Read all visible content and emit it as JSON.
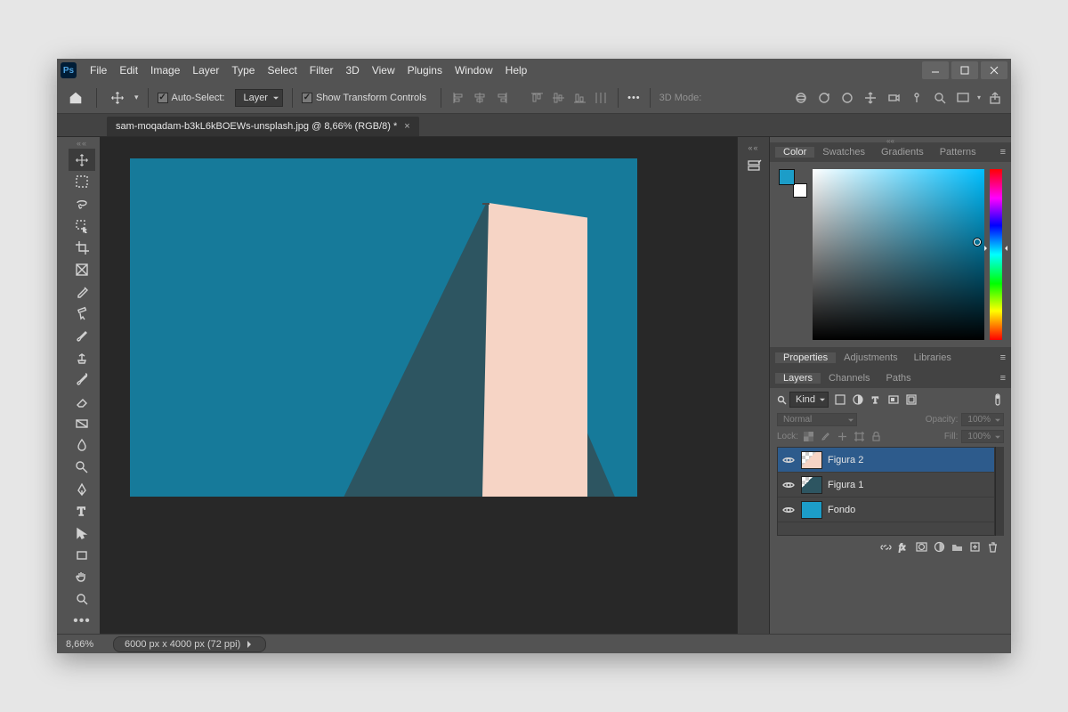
{
  "menu": {
    "items": [
      "File",
      "Edit",
      "Image",
      "Layer",
      "Type",
      "Select",
      "Filter",
      "3D",
      "View",
      "Plugins",
      "Window",
      "Help"
    ]
  },
  "options_bar": {
    "auto_select_label": "Auto-Select:",
    "auto_select_mode": "Layer",
    "show_transform_label": "Show Transform Controls",
    "mode_label_3d": "3D Mode:"
  },
  "document": {
    "tab_title": "sam-moqadam-b3kL6kBOEWs-unsplash.jpg @ 8,66% (RGB/8) *"
  },
  "color_panel": {
    "tabs": [
      "Color",
      "Swatches",
      "Gradients",
      "Patterns"
    ]
  },
  "properties_panel": {
    "tabs": [
      "Properties",
      "Adjustments",
      "Libraries"
    ]
  },
  "layers_panel": {
    "tabs": [
      "Layers",
      "Channels",
      "Paths"
    ],
    "kind_label": "Kind",
    "blend_mode": "Normal",
    "opacity_label": "Opacity:",
    "opacity_value": "100%",
    "lock_label": "Lock:",
    "fill_label": "Fill:",
    "fill_value": "100%",
    "layers": [
      {
        "name": "Figura 2"
      },
      {
        "name": "Figura 1"
      },
      {
        "name": "Fondo"
      }
    ]
  },
  "status": {
    "zoom": "8,66%",
    "doc_info": "6000 px x 4000 px (72 ppi)"
  }
}
